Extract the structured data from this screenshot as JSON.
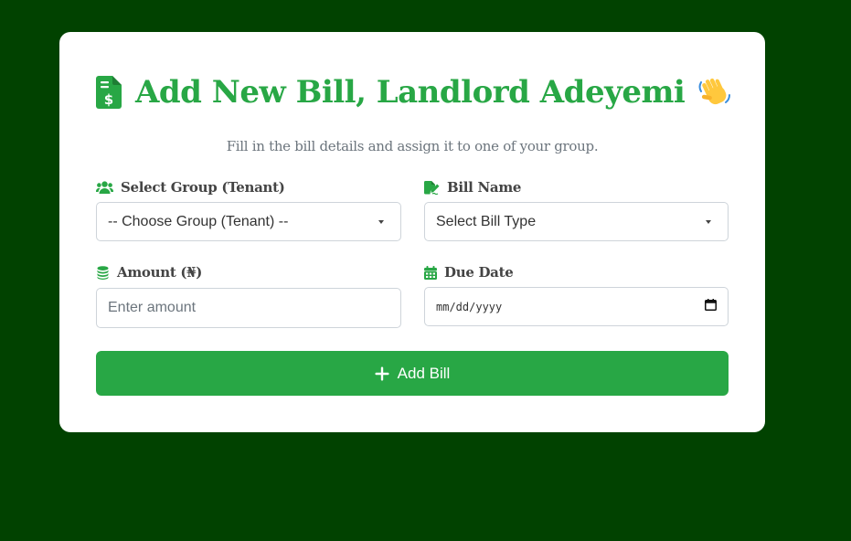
{
  "form": {
    "title": "Add New Bill, Landlord Adeyemi",
    "title_icon": "file-invoice-dollar-icon",
    "wave_icon": "waving-hand-emoji",
    "subtitle": "Fill in the bill details and assign it to one of your group.",
    "accent_color": "#28a745",
    "background_color": "#014200"
  },
  "fields": {
    "group": {
      "label": "Select Group (Tenant)",
      "icon": "users-icon",
      "selected": "-- Choose Group (Tenant) --"
    },
    "bill_name": {
      "label": "Bill Name",
      "icon": "file-signature-icon",
      "selected": "Select Bill Type"
    },
    "amount": {
      "label": "Amount (₦)",
      "icon": "coins-icon",
      "placeholder": "Enter amount",
      "value": ""
    },
    "due_date": {
      "label": "Due Date",
      "icon": "calendar-icon",
      "placeholder": "mm/dd/yyyy"
    }
  },
  "submit": {
    "label": "Add Bill",
    "icon": "plus-icon"
  }
}
